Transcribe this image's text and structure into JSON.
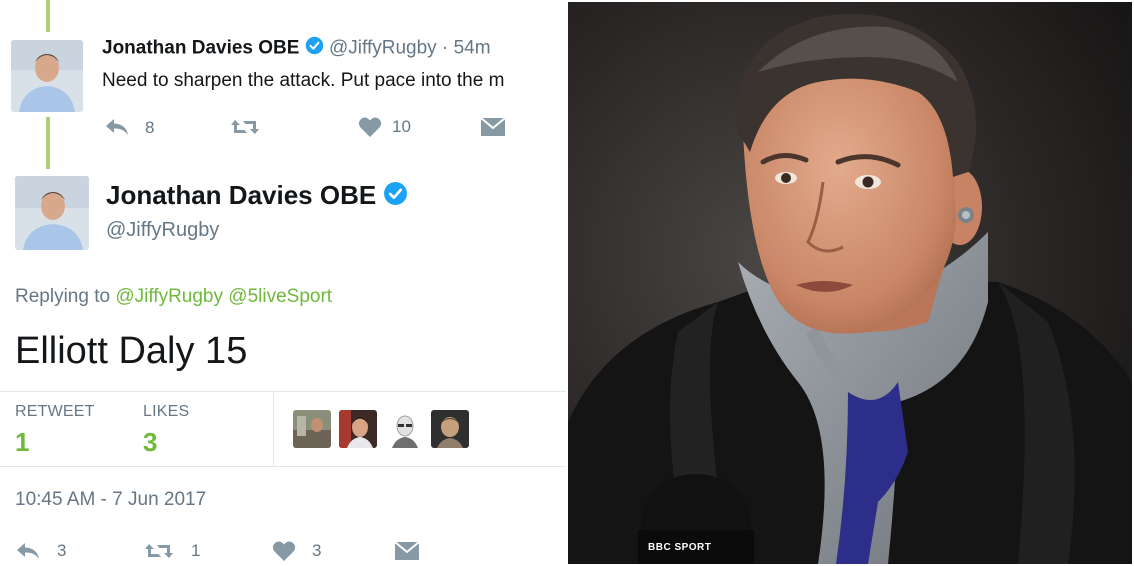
{
  "previous_tweet": {
    "author_name": "Jonathan Davies OBE",
    "author_handle": "@JiffyRugby",
    "time_sep": "·",
    "age": "54m",
    "text": "Need to sharpen the attack. Put pace into the m",
    "actions": {
      "reply_count": "",
      "retweet_count": "8",
      "like_count": "10"
    }
  },
  "main_tweet": {
    "author_name": "Jonathan Davies OBE",
    "author_handle": "@JiffyRugby",
    "replying_prefix": "Replying to",
    "reply_mentions": [
      "@JiffyRugby",
      "@5liveSport"
    ],
    "text": "Elliott Daly 15",
    "stats": {
      "retweets_label": "RETWEET",
      "retweets_value": "1",
      "likes_label": "LIKES",
      "likes_value": "3"
    },
    "timestamp": "10:45 AM - 7 Jun 2017",
    "actions": {
      "reply_count": "3",
      "retweet_count": "1",
      "like_count": "3"
    }
  },
  "icons": [
    "reply-icon",
    "retweet-icon",
    "heart-icon",
    "message-icon",
    "verified-badge-icon"
  ],
  "photo": {
    "mic_brand": "BBC SPORT"
  },
  "colors": {
    "accent_green": "#6fb93b",
    "thread_line": "#a8d677",
    "verified_blue": "#1da1f2",
    "muted": "#657786"
  }
}
